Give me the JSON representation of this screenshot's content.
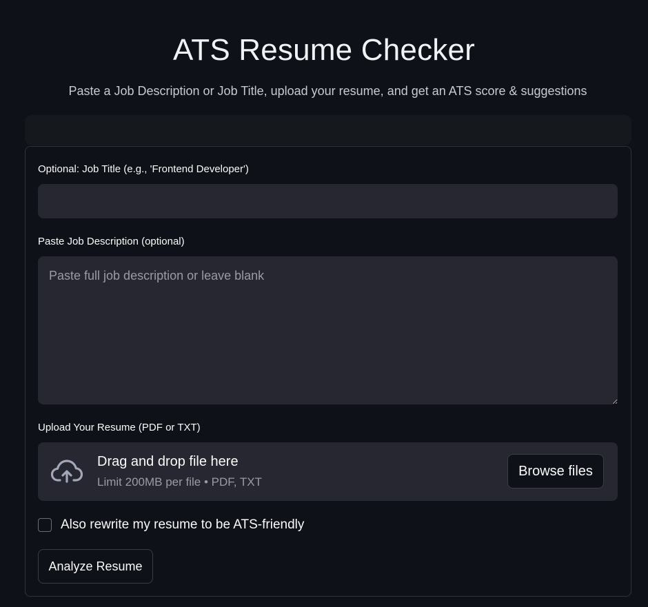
{
  "header": {
    "title": "ATS Resume Checker",
    "subtitle": "Paste a Job Description or Job Title, upload your resume, and get an ATS score & suggestions"
  },
  "form": {
    "job_title": {
      "label": "Optional: Job Title (e.g., 'Frontend Developer')",
      "value": "",
      "placeholder": ""
    },
    "job_description": {
      "label": "Paste Job Description (optional)",
      "value": "",
      "placeholder": "Paste full job description or leave blank"
    },
    "upload": {
      "label": "Upload Your Resume (PDF or TXT)",
      "drop_text": "Drag and drop file here",
      "limit_text": "Limit 200MB per file • PDF, TXT",
      "browse_label": "Browse files",
      "icon": "cloud-upload-icon"
    },
    "rewrite_checkbox": {
      "label": "Also rewrite my resume to be ATS-friendly",
      "checked": false
    },
    "analyze_label": "Analyze Resume"
  },
  "colors": {
    "background": "#0e1117",
    "input_bg": "#262730",
    "text": "#fafafa",
    "muted_text": "#9a9ca3",
    "border": "#30333b"
  }
}
